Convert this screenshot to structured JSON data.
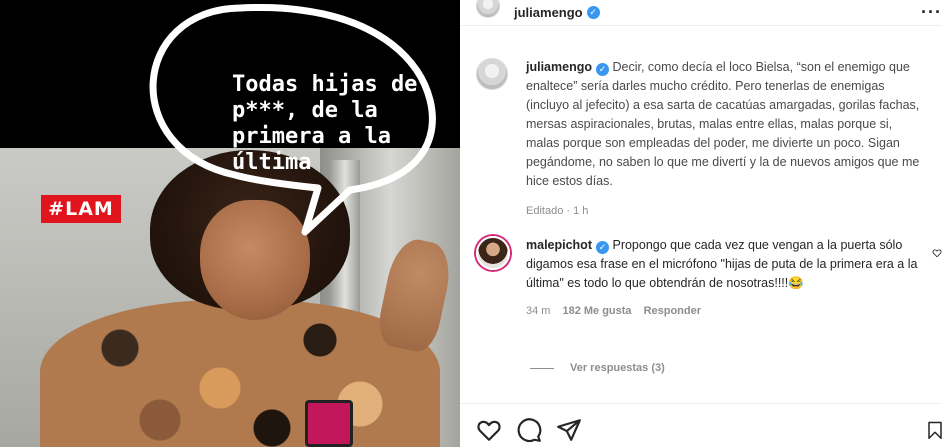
{
  "media": {
    "badge": "#LAM",
    "speech_text": "Todas hijas de p***, de la primera a la última"
  },
  "post": {
    "author": "juliamengo",
    "caption_prefix": "Decir, como decía el loco Bielsa, “son el enemigo que enaltece” sería darles mucho crédito. Pero tenerlas de enemigas (incluyo al jefecito) a esa sarta de cacatúas amargadas, gorilas fachas, mersas aspiracionales, brutas, malas entre ellas, malas porque si, malas porque son empleadas del poder, me divierte un poco. Sigan pegándome, no saben lo que me divertí y la de nuevos amigos que me hice estos días.",
    "caption_meta": "Editado · 1 h"
  },
  "comment": {
    "author": "malepichot",
    "text": "Propongo que cada vez que vengan a la puerta sólo digamos esa frase en el micrófono \"hijas de puta de la primera era a la última\" es todo lo que obtendrán de nosotras!!!!😂",
    "time": "34 m",
    "likes": "182 Me gusta",
    "reply": "Responder",
    "view_replies": "Ver respuestas (3)"
  },
  "icons": {
    "verified": "verified-check-icon",
    "more": "more-options-icon",
    "like": "heart-icon",
    "comment": "comment-bubble-icon",
    "share": "paper-plane-icon",
    "save": "bookmark-icon"
  },
  "colors": {
    "verified": "#3897f0",
    "badge": "#e1141d",
    "story_ring": "#d62976"
  }
}
